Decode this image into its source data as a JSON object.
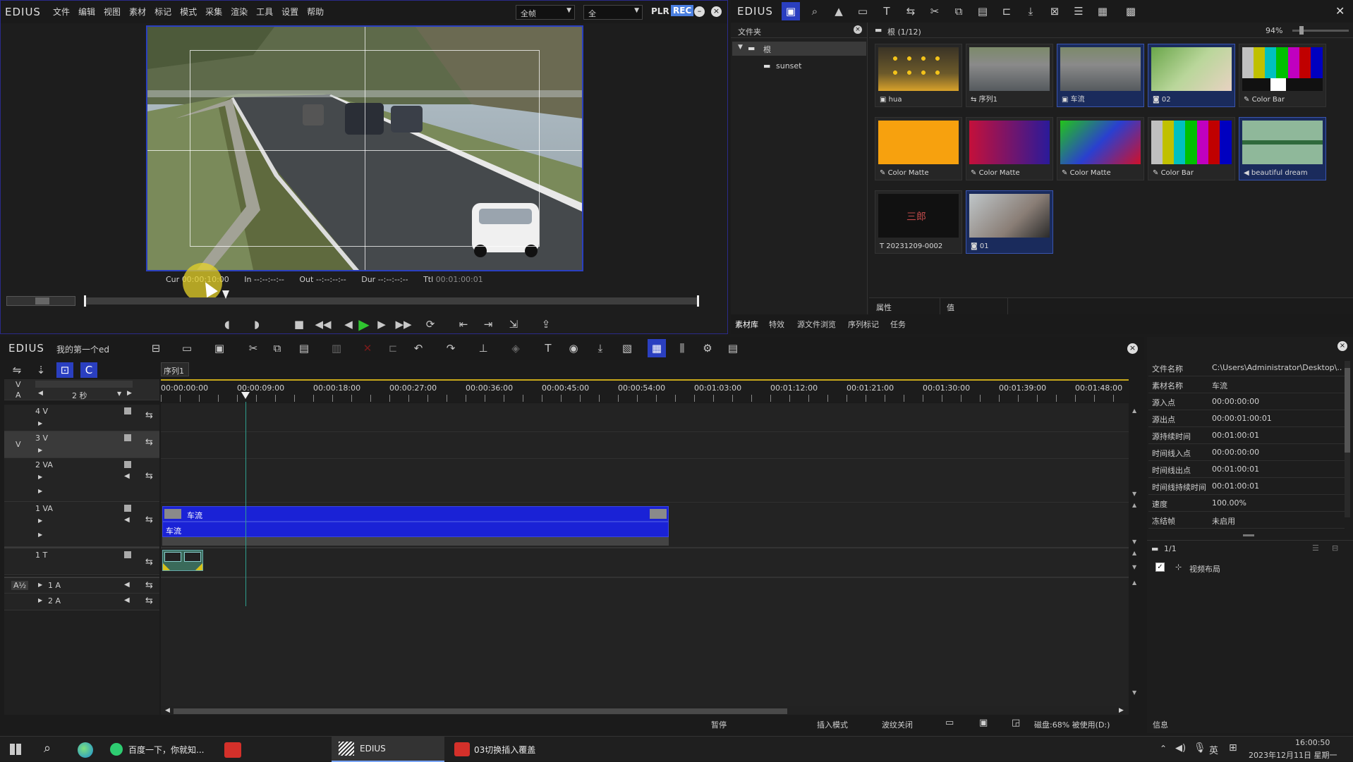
{
  "player": {
    "logo": "EDIUS",
    "menu": [
      "文件",
      "编辑",
      "视图",
      "素材",
      "标记",
      "模式",
      "采集",
      "渲染",
      "工具",
      "设置",
      "帮助"
    ],
    "dropdown1": "全帧",
    "dropdown2": "全",
    "plr": "PLR",
    "rec": "REC",
    "cur_label": "Cur",
    "cur_value": "00:00:10:00",
    "in_label": "In",
    "in_value": "--:--:--:--",
    "out_label": "Out",
    "out_value": "--:--:--:--",
    "dur_label": "Dur",
    "dur_value": "--:--:--:--",
    "ttl_label": "Ttl",
    "ttl_value": "00:01:00:01"
  },
  "bin": {
    "logo": "EDIUS",
    "folder_header": "文件夹",
    "root": "根",
    "sunset": "sunset",
    "path": "根 (1/12)",
    "zoom": "94%",
    "clips": [
      {
        "name": "hua",
        "icon": "video-icon"
      },
      {
        "name": "序列1",
        "icon": "sequence-icon"
      },
      {
        "name": "车流",
        "icon": "video-icon"
      },
      {
        "name": "02",
        "icon": "image-icon"
      },
      {
        "name": "Color Bar",
        "icon": "colorbar-icon"
      },
      {
        "name": "Color Matte",
        "icon": "matte-icon"
      },
      {
        "name": "Color Matte",
        "icon": "matte-icon"
      },
      {
        "name": "Color Matte",
        "icon": "matte-icon"
      },
      {
        "name": "Color Bar",
        "icon": "colorbar-icon"
      },
      {
        "name": "beautiful dream",
        "icon": "audio-icon"
      },
      {
        "name": "20231209-0002",
        "icon": "title-icon"
      },
      {
        "name": "01",
        "icon": "image-icon"
      }
    ],
    "title_thumb_text": "三郎",
    "prop_header": "属性",
    "value_header": "值",
    "tabs": [
      "素材库",
      "特效",
      "源文件浏览",
      "序列标记",
      "任务"
    ]
  },
  "timeline": {
    "logo": "EDIUS",
    "project": "我的第一个ed",
    "sequence_tab": "序列1",
    "scale": "2 秒",
    "ruler": [
      "00:00:00:00",
      "00:00:09:00",
      "00:00:18:00",
      "00:00:27:00",
      "00:00:36:00",
      "00:00:45:00",
      "00:00:54:00",
      "00:01:03:00",
      "00:01:12:00",
      "00:01:21:00",
      "00:01:30:00",
      "00:01:39:00",
      "00:01:48:00"
    ],
    "tracks": [
      "4 V",
      "3 V",
      "2 VA",
      "1 VA",
      "1 T",
      "1 A",
      "2 A"
    ],
    "v_label": "V",
    "a_label": "A",
    "a12_label": "A½",
    "clip_name": "车流",
    "status": {
      "pause": "暂停",
      "insert": "插入模式",
      "ripple": "波纹关闭",
      "disk": "磁盘:68% 被使用(D:)"
    }
  },
  "properties": {
    "rows": [
      {
        "k": "文件名称",
        "v": "C:\\Users\\Administrator\\Desktop\\..."
      },
      {
        "k": "素材名称",
        "v": "车流"
      },
      {
        "k": "源入点",
        "v": "00:00:00:00"
      },
      {
        "k": "源出点",
        "v": "00:00:01:00:01"
      },
      {
        "k": "源持续时间",
        "v": "00:01:00:01"
      },
      {
        "k": "时间线入点",
        "v": "00:00:00:00"
      },
      {
        "k": "时间线出点",
        "v": "00:01:00:01"
      },
      {
        "k": "时间线持续时间",
        "v": "00:01:00:01"
      },
      {
        "k": "速度",
        "v": "100.00%"
      },
      {
        "k": "冻结帧",
        "v": "未启用"
      }
    ],
    "page": "1/1",
    "effect": "视频布局",
    "info": "信息"
  },
  "taskbar": {
    "baidu": "百度一下，你就知...",
    "edius": "EDIUS",
    "video": "03切换插入覆盖",
    "lang": "英",
    "time": "16:00:50",
    "date": "2023年12月11日 星期一"
  },
  "colors": {
    "accent": "#2233cc",
    "rec": "#4a7fe0",
    "play": "#2fc42f"
  }
}
